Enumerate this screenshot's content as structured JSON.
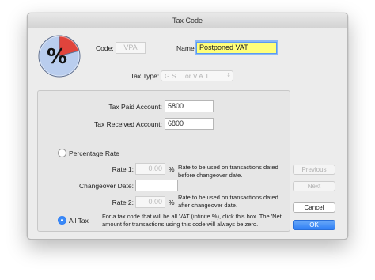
{
  "window": {
    "title": "Tax Code"
  },
  "icons": {
    "logo": "percent-pie-icon",
    "dropdown": "up-down-arrows-icon"
  },
  "header": {
    "code_label": "Code:",
    "code_value": "VPA",
    "name_label": "Name:",
    "name_value": "Postponed VAT",
    "tax_type_label": "Tax Type:",
    "tax_type_value": "G.S.T. or V.A.T."
  },
  "accounts": {
    "paid_label": "Tax Paid Account:",
    "paid_value": "5800",
    "received_label": "Tax Received Account:",
    "received_value": "6800"
  },
  "percentage": {
    "option_label": "Percentage Rate",
    "selected": false,
    "rate1_label": "Rate 1:",
    "rate1_value": "0.00",
    "rate1_unit": "%",
    "rate1_note": "Rate to be used on transactions dated before changeover date.",
    "changeover_label": "Changeover Date:",
    "changeover_value": "",
    "rate2_label": "Rate 2:",
    "rate2_value": "0.00",
    "rate2_unit": "%",
    "rate2_note": "Rate to be used on transactions dated after changeover date."
  },
  "all_tax": {
    "option_label": "All Tax",
    "selected": true,
    "note": "For a tax code that will be all VAT (infinite %), click this box. The 'Net' amount for transactions using this code will always be zero."
  },
  "buttons": {
    "previous": "Previous",
    "next": "Next",
    "cancel": "Cancel",
    "ok": "OK"
  },
  "colors": {
    "pie_fill": "#b9cdee",
    "pie_slice": "#e0443c",
    "ok_button": "#2f7ef5",
    "name_highlight": "#ffff7a"
  }
}
